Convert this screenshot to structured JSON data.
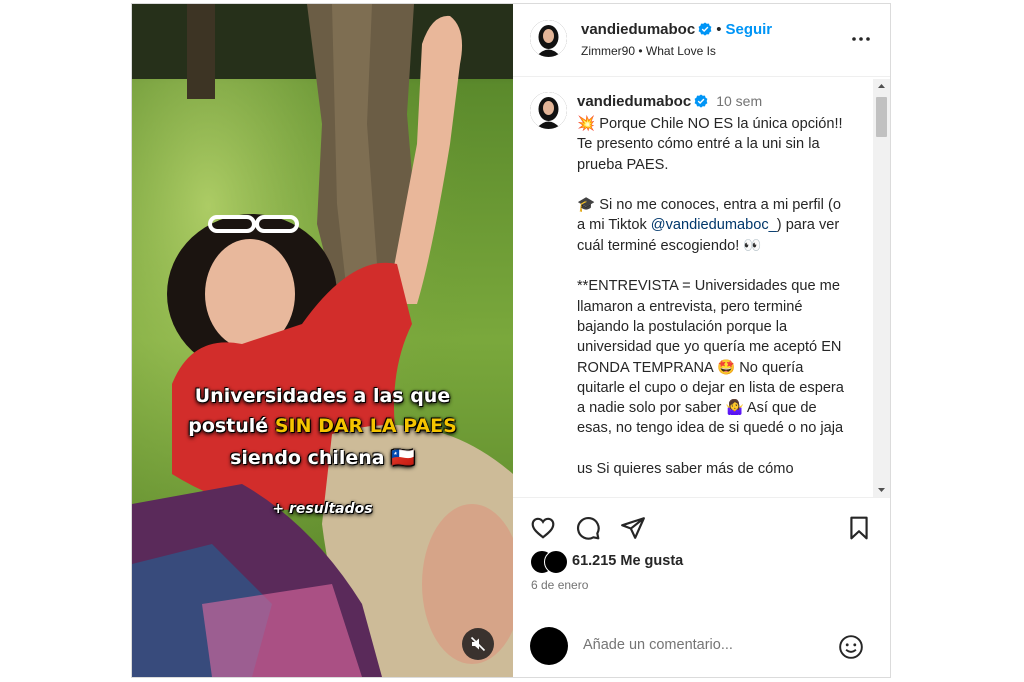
{
  "media": {
    "overlay_line1": "Universidades a las que",
    "overlay_line2_a": "postulé ",
    "overlay_line2_b": "SIN DAR LA PAES",
    "overlay_line3": "siendo chilena 🇨🇱",
    "overlay_line4": "+ resultados",
    "mute_icon": "speaker-muted-icon"
  },
  "header": {
    "username": "vandiedumaboc",
    "separator": "•",
    "follow_label": "Seguir",
    "audio_artist": "Zimmer90",
    "audio_song": "What Love Is",
    "more_icon": "more-options-icon"
  },
  "caption": {
    "username": "vandiedumaboc",
    "time": "10 sem",
    "p1": "💥 Porque Chile NO ES la única opción!! Te presento cómo entré a la uni sin la prueba PAES.",
    "p2a": "🎓 Si no me conoces, entra a mi perfil (o a mi Tiktok ",
    "p2_mention": "@vandiedumaboc_",
    "p2b": ") para ver cuál terminé escogiendo! 👀",
    "p3": "**ENTREVISTA = Universidades que me llamaron a entrevista, pero terminé bajando la postulación porque la universidad que yo quería me aceptó EN RONDA TEMPRANA 🤩 No quería quitarle el cupo o dejar en lista de espera a nadie solo por saber 🤷‍♀️ Así que de esas, no tengo idea de si quedé o no jaja",
    "p4": "us Si quieres saber más de cómo"
  },
  "actions": {
    "like_icon": "heart-icon",
    "comment_icon": "comment-icon",
    "share_icon": "share-icon",
    "save_icon": "bookmark-icon"
  },
  "likes_text": "61.215 Me gusta",
  "date": "6 de enero",
  "comment": {
    "placeholder": "Añade un comentario...",
    "emoji_icon": "emoji-icon"
  },
  "colors": {
    "follow": "#0095f6",
    "verified": "#0095f6",
    "highlight": "#f5c400"
  }
}
